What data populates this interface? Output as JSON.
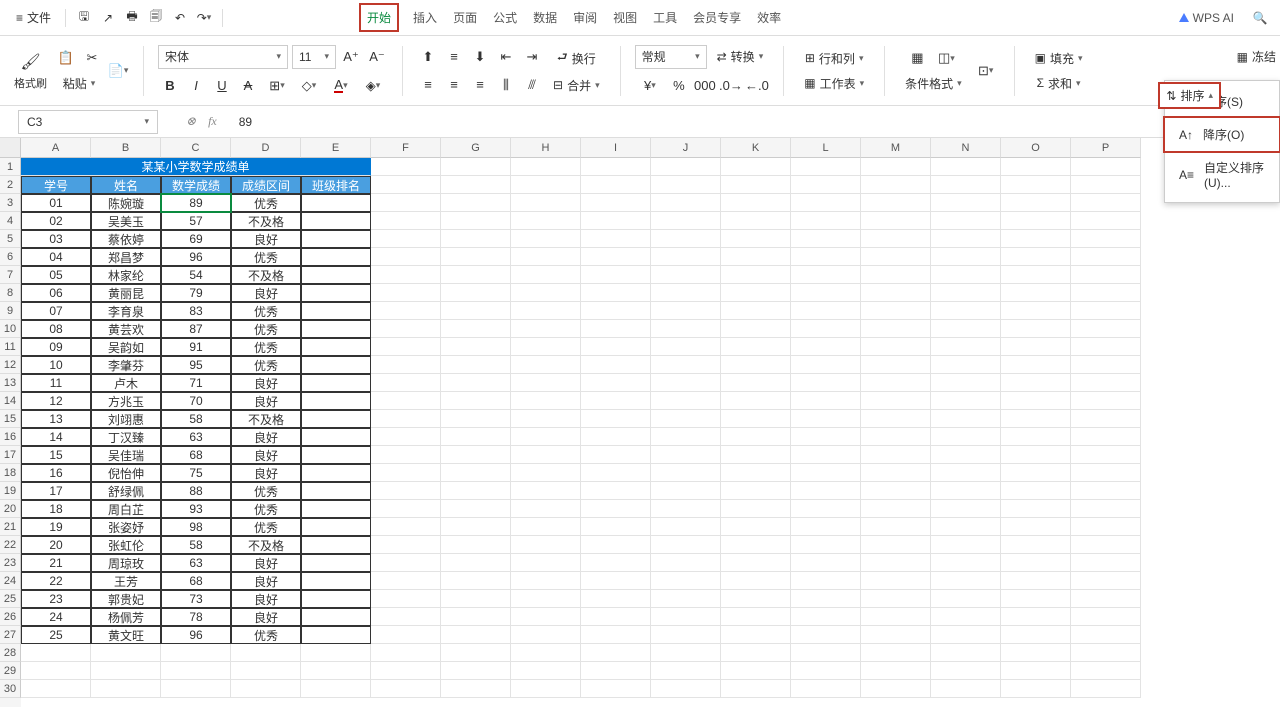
{
  "menu": {
    "file": "文件",
    "tabs": [
      "开始",
      "插入",
      "页面",
      "公式",
      "数据",
      "审阅",
      "视图",
      "工具",
      "会员专享",
      "效率"
    ],
    "active_tab_index": 0,
    "wps_ai": "WPS AI"
  },
  "ribbon": {
    "format_brush": "格式刷",
    "paste": "粘贴",
    "font_name": "宋体",
    "font_size": "11",
    "wrap": "换行",
    "merge": "合并",
    "number_format": "常规",
    "convert": "转换",
    "rowcol": "行和列",
    "worksheet": "工作表",
    "cond_format": "条件格式",
    "fill": "填充",
    "sum": "求和",
    "sort": "排序",
    "freeze": "冻结"
  },
  "name_box": {
    "cell_ref": "C3",
    "formula_value": "89"
  },
  "columns": [
    "A",
    "B",
    "C",
    "D",
    "E",
    "F",
    "G",
    "H",
    "I",
    "J",
    "K",
    "L",
    "M",
    "N",
    "O",
    "P"
  ],
  "title_row": "某某小学数学成绩单",
  "table_headers": [
    "学号",
    "姓名",
    "数学成绩",
    "成绩区间",
    "班级排名"
  ],
  "table_data": [
    [
      "01",
      "陈婉璇",
      "89",
      "优秀",
      ""
    ],
    [
      "02",
      "吴美玉",
      "57",
      "不及格",
      ""
    ],
    [
      "03",
      "蔡依婷",
      "69",
      "良好",
      ""
    ],
    [
      "04",
      "郑昌梦",
      "96",
      "优秀",
      ""
    ],
    [
      "05",
      "林家纶",
      "54",
      "不及格",
      ""
    ],
    [
      "06",
      "黄丽昆",
      "79",
      "良好",
      ""
    ],
    [
      "07",
      "李育泉",
      "83",
      "优秀",
      ""
    ],
    [
      "08",
      "黄芸欢",
      "87",
      "优秀",
      ""
    ],
    [
      "09",
      "吴韵如",
      "91",
      "优秀",
      ""
    ],
    [
      "10",
      "李肇芬",
      "95",
      "优秀",
      ""
    ],
    [
      "11",
      "卢木",
      "71",
      "良好",
      ""
    ],
    [
      "12",
      "方兆玉",
      "70",
      "良好",
      ""
    ],
    [
      "13",
      "刘翊惠",
      "58",
      "不及格",
      ""
    ],
    [
      "14",
      "丁汉臻",
      "63",
      "良好",
      ""
    ],
    [
      "15",
      "吴佳瑞",
      "68",
      "良好",
      ""
    ],
    [
      "16",
      "倪怡伸",
      "75",
      "良好",
      ""
    ],
    [
      "17",
      "舒绿佩",
      "88",
      "优秀",
      ""
    ],
    [
      "18",
      "周白芷",
      "93",
      "优秀",
      ""
    ],
    [
      "19",
      "张姿妤",
      "98",
      "优秀",
      ""
    ],
    [
      "20",
      "张虹伦",
      "58",
      "不及格",
      ""
    ],
    [
      "21",
      "周琼玫",
      "63",
      "良好",
      ""
    ],
    [
      "22",
      "王芳",
      "68",
      "良好",
      ""
    ],
    [
      "23",
      "郭贵妃",
      "73",
      "良好",
      ""
    ],
    [
      "24",
      "杨佩芳",
      "78",
      "良好",
      ""
    ],
    [
      "25",
      "黄文旺",
      "96",
      "优秀",
      ""
    ]
  ],
  "sort_menu": {
    "asc": "升序(S)",
    "desc": "降序(O)",
    "custom": "自定义排序(U)..."
  }
}
